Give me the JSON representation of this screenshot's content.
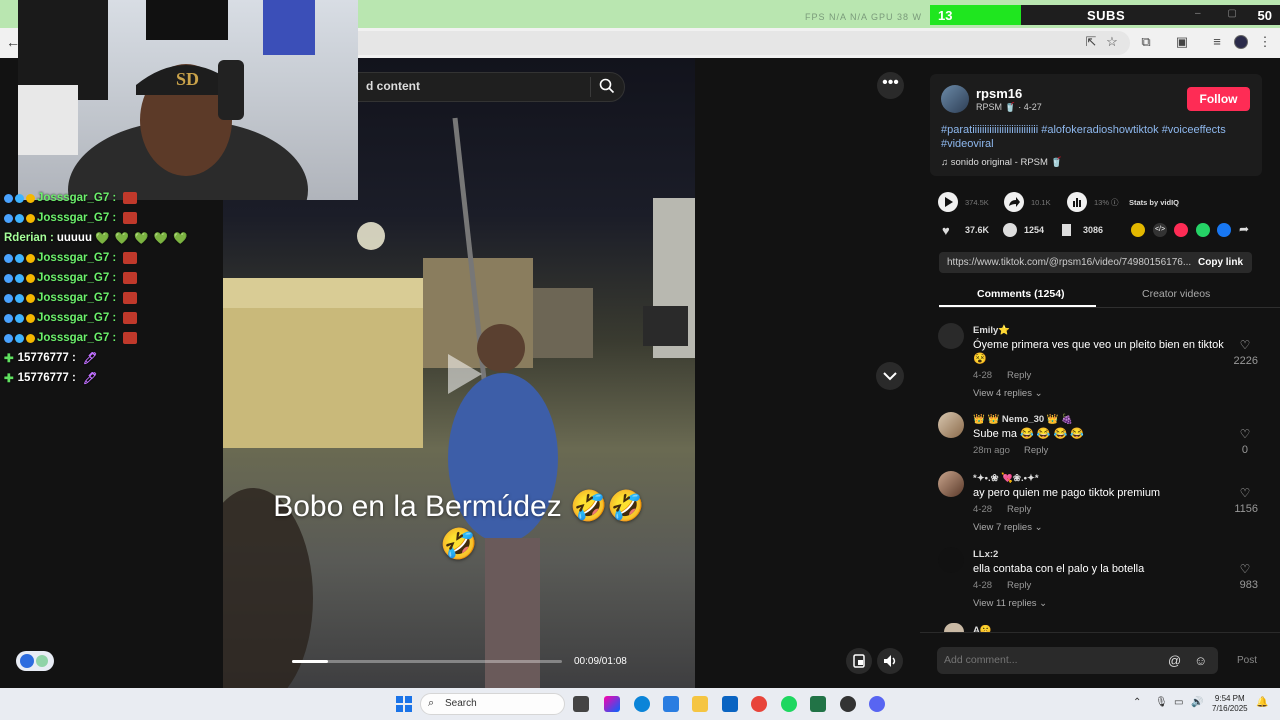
{
  "overlay": {
    "subs_count": "13",
    "subs_label": "SUBS",
    "subs_goal": "50",
    "subs_progress": 0.26,
    "stats_text": "FPS N/A  N/A   GPU 38 W"
  },
  "search": {
    "placeholder": "d content"
  },
  "chat": {
    "lines": [
      {
        "user": "Josssgar_G7 :",
        "type": "emote"
      },
      {
        "user": "Josssgar_G7 :",
        "type": "emote"
      },
      {
        "user": "Rderian :",
        "msg": "uuuuu",
        "type": "hearts",
        "hearts": "💚 💚 💚 💚 💚"
      },
      {
        "user": "Josssgar_G7 :",
        "type": "emote"
      },
      {
        "user": "Josssgar_G7 :",
        "type": "emote"
      },
      {
        "user": "Josssgar_G7 :",
        "type": "emote"
      },
      {
        "user": "Josssgar_G7 :",
        "type": "emote"
      },
      {
        "user": "Josssgar_G7 :",
        "type": "emote"
      },
      {
        "user": "15776777 :",
        "type": "pen"
      },
      {
        "user": "15776777 :",
        "type": "pen"
      }
    ]
  },
  "video": {
    "caption_line1": "Bobo en la Bermúdez 🤣🤣",
    "caption_line2": "🤣",
    "time": "00:09/01:08",
    "progress": 0.135
  },
  "author": {
    "name": "rpsm16",
    "sub": "RPSM 🥤 · 4-27",
    "follow_label": "Follow"
  },
  "description": {
    "hashtags": "#paratiiiiiiiiiiiiiiiiiiiiiiiiiii #alofokeradioshowtiktok #voiceeffects #videoviral",
    "sound": "sonido original - RPSM 🥤"
  },
  "stats": {
    "plays": "374.5K",
    "shares": "10.1K",
    "percent": "13%",
    "vidiq": "Stats by vidIQ"
  },
  "actions": {
    "likes": "37.6K",
    "comments": "1254",
    "saves": "3086"
  },
  "link": {
    "url": "https://www.tiktok.com/@rpsm16/video/74980156176...",
    "copy_label": "Copy link"
  },
  "tabs": {
    "comments": "Comments (1254)",
    "creator": "Creator videos"
  },
  "comments": [
    {
      "user": "Emily⭐",
      "text": "Óyeme primera ves que veo un pleito bien en tiktok 😵",
      "date": "4-28",
      "reply": "Reply",
      "likes": "2226",
      "view": "View 4 replies"
    },
    {
      "user": "👑 👑 Nemo_30 👑 🍇",
      "text": "Sube ma 😂 😂 😂 😂",
      "date": "28m ago",
      "reply": "Reply",
      "likes": "0",
      "view": ""
    },
    {
      "user": "*✦•.❀ 💘❀.•✦*",
      "text": "ay pero quien me pago tiktok premium",
      "date": "4-28",
      "reply": "Reply",
      "likes": "1156",
      "view": "View 7 replies"
    },
    {
      "user": "LLx:2",
      "text": "ella contaba con el palo y la botella",
      "date": "4-28",
      "reply": "Reply",
      "likes": "983",
      "view": "View 11 replies"
    },
    {
      "user": "A🤫",
      "text": "",
      "date": "",
      "reply": "",
      "likes": "",
      "view": ""
    }
  ],
  "comment_bar": {
    "placeholder": "Add comment...",
    "post_label": "Post"
  },
  "taskbar": {
    "search_label": "Search",
    "time": "9:54 PM",
    "date": "7/16/2025"
  },
  "colors": {
    "follow": "#fe2c55",
    "subs_fill": "#1fe61f",
    "hashtag": "#8eb8ee",
    "chat_user": "#6cf06c"
  }
}
